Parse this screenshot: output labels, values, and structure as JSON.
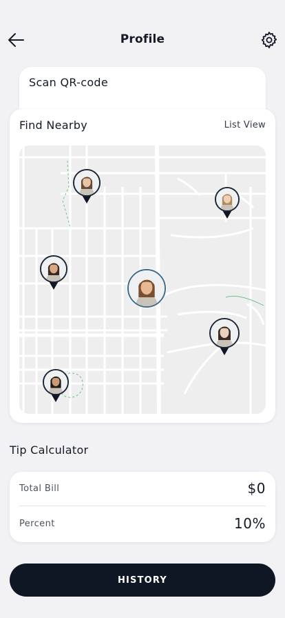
{
  "header": {
    "title": "Profile",
    "back_icon": "arrow-left-icon",
    "settings_icon": "gear-icon"
  },
  "scan": {
    "label": "Scan QR-code"
  },
  "nearby": {
    "title": "Find Nearby",
    "list_view_label": "List View",
    "pins": [
      {
        "name": "woman-long-hair",
        "skin": "#e8c3a6",
        "hair": "#6b4a35",
        "current": false
      },
      {
        "name": "woman-blonde",
        "skin": "#efcfb7",
        "hair": "#b58a5a",
        "current": false
      },
      {
        "name": "man-smiling",
        "skin": "#d9a887",
        "hair": "#3a2a20",
        "current": false
      },
      {
        "name": "current-user",
        "skin": "#e6b894",
        "hair": "#7a4e2e",
        "current": true
      },
      {
        "name": "man-short-hair",
        "skin": "#edd1bf",
        "hair": "#3b2b22",
        "current": false
      },
      {
        "name": "man-dark-hair",
        "skin": "#c99a7a",
        "hair": "#1f1a17",
        "current": false
      }
    ]
  },
  "tip": {
    "title": "Tip Calculator",
    "total_label": "Total Bill",
    "total_value": "$0",
    "percent_label": "Percent",
    "percent_value": "10%"
  },
  "history": {
    "label": "HISTORY"
  },
  "colors": {
    "primary": "#0f1724",
    "background": "#f2f2f4",
    "card": "#ffffff",
    "map_bg": "#f1f1f2",
    "street": "#ffffff",
    "park": "#6fbf8f"
  }
}
